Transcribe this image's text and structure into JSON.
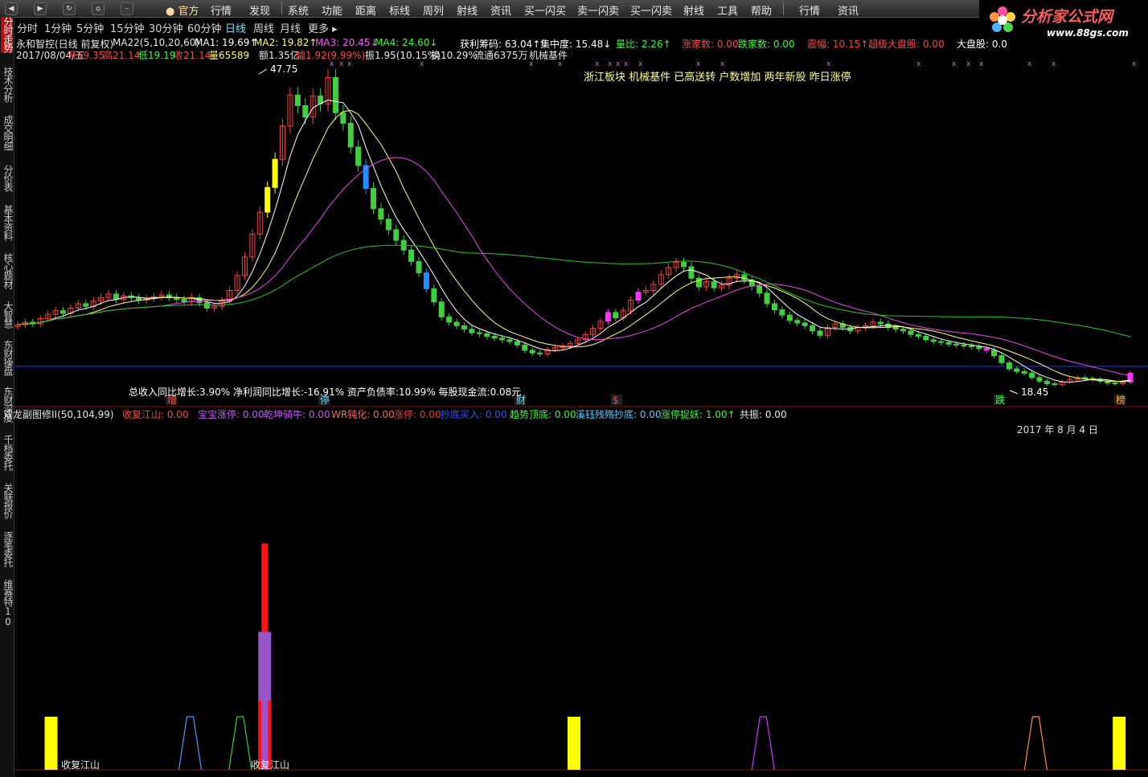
{
  "menu": {
    "items": [
      "官方",
      "行情",
      "发现",
      "系统",
      "功能",
      "距离",
      "标线",
      "周列",
      "射线",
      "资讯",
      "买一闪买",
      "卖一闪卖",
      "买一闪卖",
      "射线",
      "工具",
      "帮助",
      "行情",
      "资讯"
    ],
    "nav_icons": [
      "back-icon",
      "forward-icon",
      "refresh-icon",
      "home-icon",
      "minimize-icon"
    ]
  },
  "logo": {
    "name": "分析家公式网",
    "url_text": "www.88gs.com"
  },
  "left_tabs": [
    "分时走势",
    "技术分析",
    "成交明细",
    "分价表",
    "基本资料",
    "核心题材",
    "大智慧",
    "东财操盘",
    "东财深度",
    "千档委托",
    "关联报价",
    "逐笔委托",
    "维赛特10"
  ],
  "periods": [
    "分时",
    "1分钟",
    "5分钟",
    "15分钟",
    "30分钟",
    "60分钟",
    "日线",
    "周线",
    "月线",
    "更多 ▸"
  ],
  "active_period": "日线",
  "header": {
    "stock": "永和智控(日线 前复权)",
    "ma": [
      {
        "label": "MA22(5,10,20,60)",
        "color": "#e8e8e8"
      },
      {
        "label": "MA1: 19.69↑",
        "color": "#ffffff"
      },
      {
        "label": "MA2: 19.82↑",
        "color": "#ffff66"
      },
      {
        "label": "MA3: 20.45↓",
        "color": "#ff55ff"
      },
      {
        "label": "MA4: 24.60↓",
        "color": "#33ff33"
      }
    ],
    "right_stats": [
      {
        "label": "获利筹码: 63.04↑",
        "color": "#ffffff"
      },
      {
        "label": "集中度: 15.48↓",
        "color": "#ffffff"
      },
      {
        "label": "量比: 2.26↑",
        "color": "#33ff33"
      },
      {
        "label": "涨家数: 0.00",
        "color": "#ff4444"
      },
      {
        "label": "跌家数: 0.00",
        "color": "#33ff33"
      },
      {
        "label": "震幅: 10.15↑",
        "color": "#ff4444"
      },
      {
        "label": "超级大盘股: 0.00",
        "color": "#ff4444"
      },
      {
        "label": "大盘股: 0.0",
        "color": "#ffffff"
      }
    ],
    "quote_line2": [
      {
        "label": "2017/08/04/五",
        "color": "#e8e8e8"
      },
      {
        "label": "开19.35",
        "color": "#ff4444"
      },
      {
        "label": "高21.14",
        "color": "#ff4444"
      },
      {
        "label": "低19.19",
        "color": "#33ff33"
      },
      {
        "label": "收21.14",
        "color": "#ff4444"
      },
      {
        "label": "量65589",
        "color": "#ffff66"
      },
      {
        "label": "额1.35亿",
        "color": "#e8e8e8"
      },
      {
        "label": "幅1.92(9.99%)",
        "color": "#ff4444"
      },
      {
        "label": "振1.95(10.15%)",
        "color": "#e8e8e8"
      },
      {
        "label": "换10.29%",
        "color": "#e8e8e8"
      },
      {
        "label": "流通6375万",
        "color": "#e8e8e8"
      },
      {
        "label": "机械基件",
        "color": "#e8e8e8"
      }
    ]
  },
  "annotation_concepts": "浙江板块 机械基件 已高送转 户数增加 两年新股 昨日涨停",
  "high_label": "47.75",
  "low_label": "18.45",
  "fundamentals": "总收入同比增长:3.90%  净利润同比增长:-16.91%  资产负债率:10.99%  每股现金流:0.08元",
  "markers": [
    {
      "label": "增",
      "color": "#ff4444"
    },
    {
      "label": "停",
      "color": "#55ddff"
    },
    {
      "label": "财",
      "color": "#55ddff"
    },
    {
      "label": "$",
      "color": "#ff4444"
    },
    {
      "label": "跌",
      "color": "#33ff33"
    },
    {
      "label": "榜",
      "color": "#ffaa44"
    }
  ],
  "indicator": {
    "title": "双龙副图修II(50,104,99)",
    "items": [
      {
        "label": "收复江山: 0.00",
        "color": "#ff4444"
      },
      {
        "label": "宝宝涨停: 0.00",
        "color": "#cc55ff"
      },
      {
        "label": "乾坤骑牛: 0.00",
        "color": "#cc55ff"
      },
      {
        "label": "WR钝化: 0.00",
        "color": "#ff6666"
      },
      {
        "label": "涨停: 0.00",
        "color": "#ff3333"
      },
      {
        "label": "抄底买入: 0.00",
        "color": "#3355ff"
      },
      {
        "label": "趋势顶底: 0.00",
        "color": "#33ff33"
      },
      {
        "label": "溪钰残殇抄底: 0.00",
        "color": "#55ccff"
      },
      {
        "label": "涨停捉妖: 1.00↑",
        "color": "#33ff33"
      },
      {
        "label": "共振: 0.00",
        "color": "#e8e8e8"
      }
    ],
    "date": "2017 年 8 月 4 日",
    "bottom_labels": [
      "收复江山",
      "收复江山"
    ]
  },
  "colors": {
    "up": "#ff3b3b",
    "down": "#3fcf3f",
    "yellow": "#ffff00",
    "magenta": "#ff33ff",
    "cyan_bar": "#1e90ff",
    "ma1": "#ffffff",
    "ma2": "#ffff66",
    "ma3": "#ee44ee",
    "ma4": "#22cc22",
    "baseline": "#2233ff"
  },
  "chart_data": {
    "type": "line",
    "note_units": "price, yuan",
    "closes": [
      18.9,
      19.2,
      19.0,
      19.6,
      20.1,
      20.5,
      20.2,
      20.8,
      21.3,
      21.0,
      21.6,
      22.0,
      22.4,
      21.8,
      22.2,
      22.0,
      21.7,
      21.9,
      22.1,
      22.3,
      22.0,
      21.8,
      21.5,
      22.0,
      21.4,
      20.8,
      21.0,
      21.6,
      22.8,
      24.5,
      26.6,
      29.2,
      31.7,
      34.5,
      37.7,
      41.5,
      45.0,
      43.8,
      42.5,
      44.9,
      44.0,
      47.0,
      43.0,
      41.8,
      39.1,
      37.0,
      34.4,
      32.1,
      30.9,
      29.7,
      28.5,
      27.4,
      26.1,
      24.8,
      23.0,
      21.5,
      19.8,
      19.2,
      18.8,
      18.4,
      18.0,
      17.9,
      17.6,
      17.4,
      17.2,
      17.0,
      16.6,
      16.0,
      15.7,
      15.6,
      16.1,
      16.3,
      16.5,
      16.8,
      17.2,
      17.8,
      18.5,
      19.3,
      20.3,
      19.7,
      20.5,
      21.7,
      22.6,
      22.8,
      23.5,
      24.6,
      25.4,
      26.0,
      25.5,
      24.2,
      23.2,
      23.8,
      23.1,
      23.4,
      24.2,
      24.6,
      24.0,
      23.3,
      22.5,
      21.3,
      20.6,
      20.0,
      19.4,
      19.1,
      18.8,
      18.2,
      17.7,
      18.6,
      19.0,
      18.6,
      18.2,
      18.6,
      18.8,
      19.2,
      19.0,
      18.6,
      18.4,
      18.2,
      17.8,
      17.6,
      17.2,
      17.0,
      16.9,
      16.7,
      16.6,
      16.5,
      16.4,
      16.2,
      16.0,
      15.4,
      14.6,
      13.9,
      13.6,
      13.4,
      12.9,
      12.5,
      12.2,
      12.1,
      12.4,
      12.7,
      12.9,
      12.8,
      12.7,
      12.5,
      12.3,
      12.2,
      12.4,
      13.4
    ],
    "indicator_spikes": [
      {
        "pos": 0.03,
        "type": "bar",
        "color": "#ffff00",
        "value": 1
      },
      {
        "pos": 0.155,
        "type": "tri",
        "color": "#4499ff",
        "value": 1
      },
      {
        "pos": 0.2,
        "type": "tri",
        "color": "#33cc33",
        "value": 1
      },
      {
        "pos": 0.222,
        "type": "bar",
        "color": "#9955cc",
        "value": 2.6
      },
      {
        "pos": 0.222,
        "type": "bar",
        "color": "#ff1111",
        "value": 1.3
      },
      {
        "pos": 0.5,
        "type": "bar",
        "color": "#ffff00",
        "value": 1
      },
      {
        "pos": 0.67,
        "type": "tri",
        "color": "#cc33ff",
        "value": 1
      },
      {
        "pos": 0.915,
        "type": "tri",
        "color": "#ff8844",
        "value": 1
      },
      {
        "pos": 0.99,
        "type": "bar",
        "color": "#ffff00",
        "value": 1
      }
    ]
  }
}
